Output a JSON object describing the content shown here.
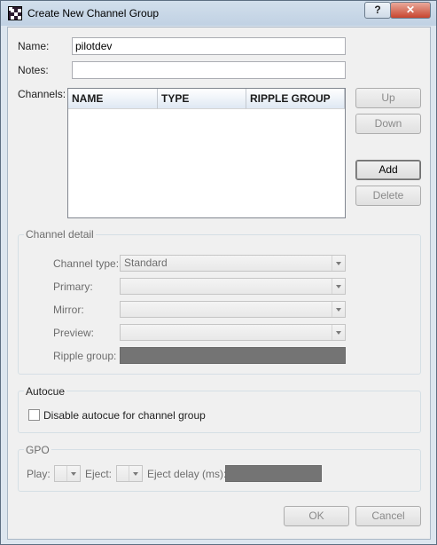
{
  "window": {
    "title": "Create New Channel Group",
    "help_label": "?",
    "close_label": "✕"
  },
  "form": {
    "name_label": "Name:",
    "name_value": "pilotdev",
    "notes_label": "Notes:",
    "notes_value": "",
    "channels_label": "Channels:"
  },
  "channels_table": {
    "columns": [
      "NAME",
      "TYPE",
      "RIPPLE GROUP"
    ],
    "rows": []
  },
  "side_buttons": {
    "up": "Up",
    "down": "Down",
    "add": "Add",
    "delete": "Delete"
  },
  "channel_detail": {
    "title": "Channel detail",
    "channel_type_label": "Channel type:",
    "channel_type_value": "Standard",
    "primary_label": "Primary:",
    "primary_value": "",
    "mirror_label": "Mirror:",
    "mirror_value": "",
    "preview_label": "Preview:",
    "preview_value": "",
    "ripple_group_label": "Ripple group:"
  },
  "autocue": {
    "title": "Autocue",
    "disable_label": "Disable autocue for channel group",
    "disable_checked": false
  },
  "gpo": {
    "title": "GPO",
    "play_label": "Play:",
    "eject_label": "Eject:",
    "eject_delay_label": "Eject delay (ms):"
  },
  "footer": {
    "ok": "OK",
    "cancel": "Cancel"
  }
}
